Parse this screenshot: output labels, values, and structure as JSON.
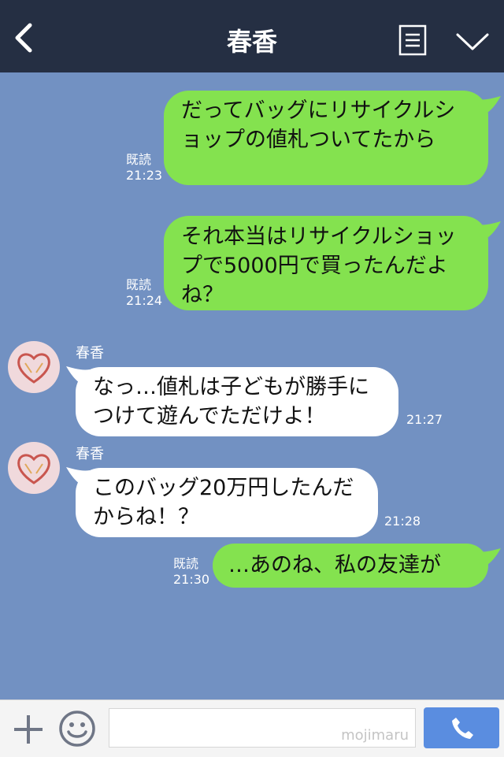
{
  "header": {
    "title": "春香",
    "icons": [
      "back-icon",
      "menu-icon",
      "chevron-down-icon"
    ]
  },
  "messages": [
    {
      "side": "me",
      "text": "だってバッグにリサイクルショップの値札ついてたから",
      "read": "既読",
      "time": "21:23"
    },
    {
      "side": "me",
      "text": "それ本当はリサイクルショップで5000円で買ったんだよね？",
      "read": "既読",
      "time": "21:24"
    },
    {
      "side": "them",
      "sender": "春香",
      "text": "なっ…値札は子どもが勝手につけて遊んでただけよ！",
      "time": "21:27"
    },
    {
      "side": "them",
      "sender": "春香",
      "text": "このバッグ20万円したんだからね！？",
      "time": "21:28"
    },
    {
      "side": "me",
      "text": "…あのね、私の友達が",
      "read": "既読",
      "time": "21:30"
    }
  ],
  "footer": {
    "watermark": "mojimaru",
    "icons": [
      "plus-icon",
      "smile-icon",
      "phone-icon"
    ]
  },
  "colors": {
    "header_bg": "#252f43",
    "chat_bg": "#7291c2",
    "my_bubble": "#84e24f",
    "their_bubble": "#ffffff",
    "call_button": "#5a8de0"
  }
}
